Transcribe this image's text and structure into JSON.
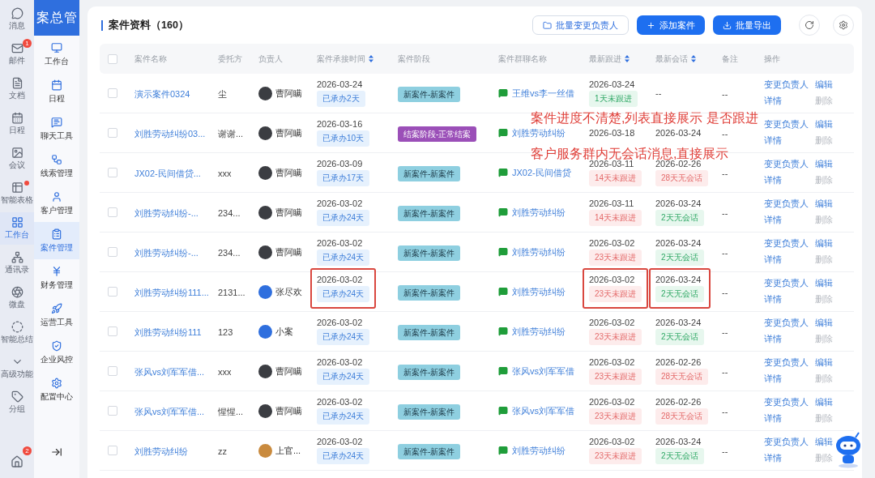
{
  "rail": {
    "items": [
      {
        "label": "消息",
        "dot": false,
        "selected": false
      },
      {
        "label": "邮件",
        "badge": "1",
        "dot": false,
        "selected": false
      },
      {
        "label": "文档",
        "dot": false,
        "selected": false
      },
      {
        "label": "日程",
        "dot": false,
        "selected": false
      },
      {
        "label": "会议",
        "dot": false,
        "selected": false
      },
      {
        "label": "智能表格",
        "dot": true,
        "selected": false
      },
      {
        "label": "工作台",
        "dot": false,
        "selected": true
      },
      {
        "label": "通讯录",
        "dot": false,
        "selected": false
      },
      {
        "label": "微盘",
        "dot": false,
        "selected": false
      },
      {
        "label": "智能总结",
        "dot": false,
        "selected": false
      },
      {
        "label": "高级功能",
        "dot": false,
        "selected": false
      },
      {
        "label": "分组",
        "dot": false,
        "selected": false
      }
    ],
    "bottom_badge": "2"
  },
  "nav": {
    "logo": "案总管",
    "items": [
      {
        "label": "工作台",
        "selected": false
      },
      {
        "label": "日程",
        "selected": false
      },
      {
        "label": "聊天工具",
        "selected": false
      },
      {
        "label": "线索管理",
        "selected": false
      },
      {
        "label": "客户管理",
        "selected": false
      },
      {
        "label": "案件管理",
        "selected": true
      },
      {
        "label": "财务管理",
        "selected": false
      },
      {
        "label": "运营工具",
        "selected": false
      },
      {
        "label": "企业风控",
        "selected": false
      },
      {
        "label": "配置中心",
        "selected": false
      }
    ]
  },
  "page": {
    "title": "案件资料（160）",
    "actions": [
      {
        "label": "批量变更负责人",
        "kind": "outline"
      },
      {
        "label": "添加案件",
        "kind": "add"
      },
      {
        "label": "批量导出",
        "kind": "export"
      }
    ]
  },
  "table": {
    "header_checked": false,
    "columns": [
      {
        "label": "案件名称",
        "sortable": false
      },
      {
        "label": "委托方",
        "sortable": false
      },
      {
        "label": "负责人",
        "sortable": false
      },
      {
        "label": "案件承接时间",
        "sortable": true
      },
      {
        "label": "案件阶段",
        "sortable": false
      },
      {
        "label": "案件群聊名称",
        "sortable": false
      },
      {
        "label": "最新跟进",
        "sortable": true
      },
      {
        "label": "最新会话",
        "sortable": true
      },
      {
        "label": "备注",
        "sortable": false
      },
      {
        "label": "操作",
        "sortable": false
      }
    ],
    "rows": [
      {
        "checked": false,
        "highlighted": false,
        "name": "演示案件0324",
        "client": "尘",
        "owner": {
          "name": "曹阿瞒",
          "kind": "photo"
        },
        "accepted": {
          "date": "2026-03-24",
          "tag": "已承办2天"
        },
        "stage": {
          "label": "新案件-新案件",
          "kind": "new"
        },
        "group": "王维vs李一丝借",
        "follow": {
          "date": "2026-03-24",
          "tag": "1天未跟进",
          "overdue": false
        },
        "chat": {
          "date": "--"
        },
        "note": "--",
        "actions": [
          {
            "label": "变更负责人",
            "disabled": false
          },
          {
            "label": "编辑",
            "disabled": false
          },
          {
            "label": "详情",
            "disabled": false
          },
          {
            "label": "删除",
            "disabled": true
          }
        ]
      },
      {
        "checked": false,
        "highlighted": false,
        "name": "刘胜劳动纠纷03...",
        "client": "谢谢...",
        "owner": {
          "name": "曹阿瞒",
          "kind": "photo"
        },
        "accepted": {
          "date": "2026-03-16",
          "tag": "已承办10天"
        },
        "stage": {
          "label": "结案阶段-正常结案",
          "kind": "closed"
        },
        "group": "刘胜劳动纠纷",
        "follow": {
          "date": "2026-03-18"
        },
        "chat": {
          "date": "2026-03-24"
        },
        "note": "--",
        "actions": [
          {
            "label": "变更负责人",
            "disabled": false
          },
          {
            "label": "编辑",
            "disabled": false
          },
          {
            "label": "详情",
            "disabled": false
          },
          {
            "label": "删除",
            "disabled": true
          }
        ]
      },
      {
        "checked": false,
        "highlighted": false,
        "name": "JX02-民间借贷...",
        "client": "xxx",
        "owner": {
          "name": "曹阿瞒",
          "kind": "photo"
        },
        "accepted": {
          "date": "2026-03-09",
          "tag": "已承办17天"
        },
        "stage": {
          "label": "新案件-新案件",
          "kind": "new"
        },
        "group": "JX02-民间借贷",
        "follow": {
          "date": "2026-03-11",
          "tag": "14天未跟进",
          "overdue": true
        },
        "chat": {
          "date": "2026-02-26",
          "tag": "28天无会话",
          "overdue": true
        },
        "note": "--",
        "actions": [
          {
            "label": "变更负责人",
            "disabled": false
          },
          {
            "label": "编辑",
            "disabled": false
          },
          {
            "label": "详情",
            "disabled": false
          },
          {
            "label": "删除",
            "disabled": true
          }
        ]
      },
      {
        "checked": false,
        "highlighted": false,
        "name": "刘胜劳动纠纷-...",
        "client": "234...",
        "owner": {
          "name": "曹阿瞒",
          "kind": "photo"
        },
        "accepted": {
          "date": "2026-03-02",
          "tag": "已承办24天"
        },
        "stage": {
          "label": "新案件-新案件",
          "kind": "new"
        },
        "group": "刘胜劳动纠纷",
        "follow": {
          "date": "2026-03-11",
          "tag": "14天未跟进",
          "overdue": true
        },
        "chat": {
          "date": "2026-03-24",
          "tag": "2天无会话",
          "overdue": false
        },
        "note": "--",
        "actions": [
          {
            "label": "变更负责人",
            "disabled": false
          },
          {
            "label": "编辑",
            "disabled": false
          },
          {
            "label": "详情",
            "disabled": false
          },
          {
            "label": "删除",
            "disabled": true
          }
        ]
      },
      {
        "checked": false,
        "highlighted": false,
        "name": "刘胜劳动纠纷-...",
        "client": "234...",
        "owner": {
          "name": "曹阿瞒",
          "kind": "photo"
        },
        "accepted": {
          "date": "2026-03-02",
          "tag": "已承办24天"
        },
        "stage": {
          "label": "新案件-新案件",
          "kind": "new"
        },
        "group": "刘胜劳动纠纷",
        "follow": {
          "date": "2026-03-02",
          "tag": "23天未跟进",
          "overdue": true
        },
        "chat": {
          "date": "2026-03-24",
          "tag": "2天无会话",
          "overdue": false
        },
        "note": "--",
        "actions": [
          {
            "label": "变更负责人",
            "disabled": false
          },
          {
            "label": "编辑",
            "disabled": false
          },
          {
            "label": "详情",
            "disabled": false
          },
          {
            "label": "删除",
            "disabled": true
          }
        ]
      },
      {
        "checked": false,
        "highlighted": true,
        "name": "刘胜劳动纠纷111...",
        "client": "2131...",
        "owner": {
          "name": "张尽欢",
          "kind": "logo"
        },
        "accepted": {
          "date": "2026-03-02",
          "tag": "已承办24天"
        },
        "stage": {
          "label": "新案件-新案件",
          "kind": "new"
        },
        "group": "刘胜劳动纠纷",
        "follow": {
          "date": "2026-03-02",
          "tag": "23天未跟进",
          "overdue": true
        },
        "chat": {
          "date": "2026-03-24",
          "tag": "2天无会话",
          "overdue": false
        },
        "note": "--",
        "actions": [
          {
            "label": "变更负责人",
            "disabled": false
          },
          {
            "label": "编辑",
            "disabled": false
          },
          {
            "label": "详情",
            "disabled": false
          },
          {
            "label": "删除",
            "disabled": true
          }
        ]
      },
      {
        "checked": false,
        "highlighted": false,
        "name": "刘胜劳动纠纷111",
        "client": "123",
        "owner": {
          "name": "小案",
          "kind": "logo"
        },
        "accepted": {
          "date": "2026-03-02",
          "tag": "已承办24天"
        },
        "stage": {
          "label": "新案件-新案件",
          "kind": "new"
        },
        "group": "刘胜劳动纠纷",
        "follow": {
          "date": "2026-03-02",
          "tag": "23天未跟进",
          "overdue": true
        },
        "chat": {
          "date": "2026-03-24",
          "tag": "2天无会话",
          "overdue": false
        },
        "note": "--",
        "actions": [
          {
            "label": "变更负责人",
            "disabled": false
          },
          {
            "label": "编辑",
            "disabled": false
          },
          {
            "label": "详情",
            "disabled": false
          },
          {
            "label": "删除",
            "disabled": true
          }
        ]
      },
      {
        "checked": false,
        "highlighted": false,
        "name": "张风vs刘军军借...",
        "client": "xxx",
        "owner": {
          "name": "曹阿瞒",
          "kind": "photo"
        },
        "accepted": {
          "date": "2026-03-02",
          "tag": "已承办24天"
        },
        "stage": {
          "label": "新案件-新案件",
          "kind": "new"
        },
        "group": "张风vs刘军军借",
        "follow": {
          "date": "2026-03-02",
          "tag": "23天未跟进",
          "overdue": true
        },
        "chat": {
          "date": "2026-02-26",
          "tag": "28天无会话",
          "overdue": true
        },
        "note": "--",
        "actions": [
          {
            "label": "变更负责人",
            "disabled": false
          },
          {
            "label": "编辑",
            "disabled": false
          },
          {
            "label": "详情",
            "disabled": false
          },
          {
            "label": "删除",
            "disabled": true
          }
        ]
      },
      {
        "checked": false,
        "highlighted": false,
        "name": "张风vs刘军军借...",
        "client": "惺惺...",
        "owner": {
          "name": "曹阿瞒",
          "kind": "photo"
        },
        "accepted": {
          "date": "2026-03-02",
          "tag": "已承办24天"
        },
        "stage": {
          "label": "新案件-新案件",
          "kind": "new"
        },
        "group": "张风vs刘军军借",
        "follow": {
          "date": "2026-03-02",
          "tag": "23天未跟进",
          "overdue": true
        },
        "chat": {
          "date": "2026-02-26",
          "tag": "28天无会话",
          "overdue": true
        },
        "note": "--",
        "actions": [
          {
            "label": "变更负责人",
            "disabled": false
          },
          {
            "label": "编辑",
            "disabled": false
          },
          {
            "label": "详情",
            "disabled": false
          },
          {
            "label": "删除",
            "disabled": true
          }
        ]
      },
      {
        "checked": false,
        "highlighted": false,
        "name": "刘胜劳动纠纷",
        "client": "zz",
        "owner": {
          "name": "上官...",
          "kind": "warm"
        },
        "accepted": {
          "date": "2026-03-02",
          "tag": "已承办24天"
        },
        "stage": {
          "label": "新案件-新案件",
          "kind": "new"
        },
        "group": "刘胜劳动纠纷",
        "follow": {
          "date": "2026-03-02",
          "tag": "23天未跟进",
          "overdue": true
        },
        "chat": {
          "date": "2026-03-24",
          "tag": "2天无会话",
          "overdue": false
        },
        "note": "--",
        "actions": [
          {
            "label": "变更负责人",
            "disabled": false
          },
          {
            "label": "编辑",
            "disabled": false
          },
          {
            "label": "详情",
            "disabled": false
          },
          {
            "label": "删除",
            "disabled": true
          }
        ]
      }
    ]
  },
  "annotations": [
    "案件进度不清楚,列表直接展示 是否跟进",
    "客户服务群内无会话消息,直接展示"
  ]
}
